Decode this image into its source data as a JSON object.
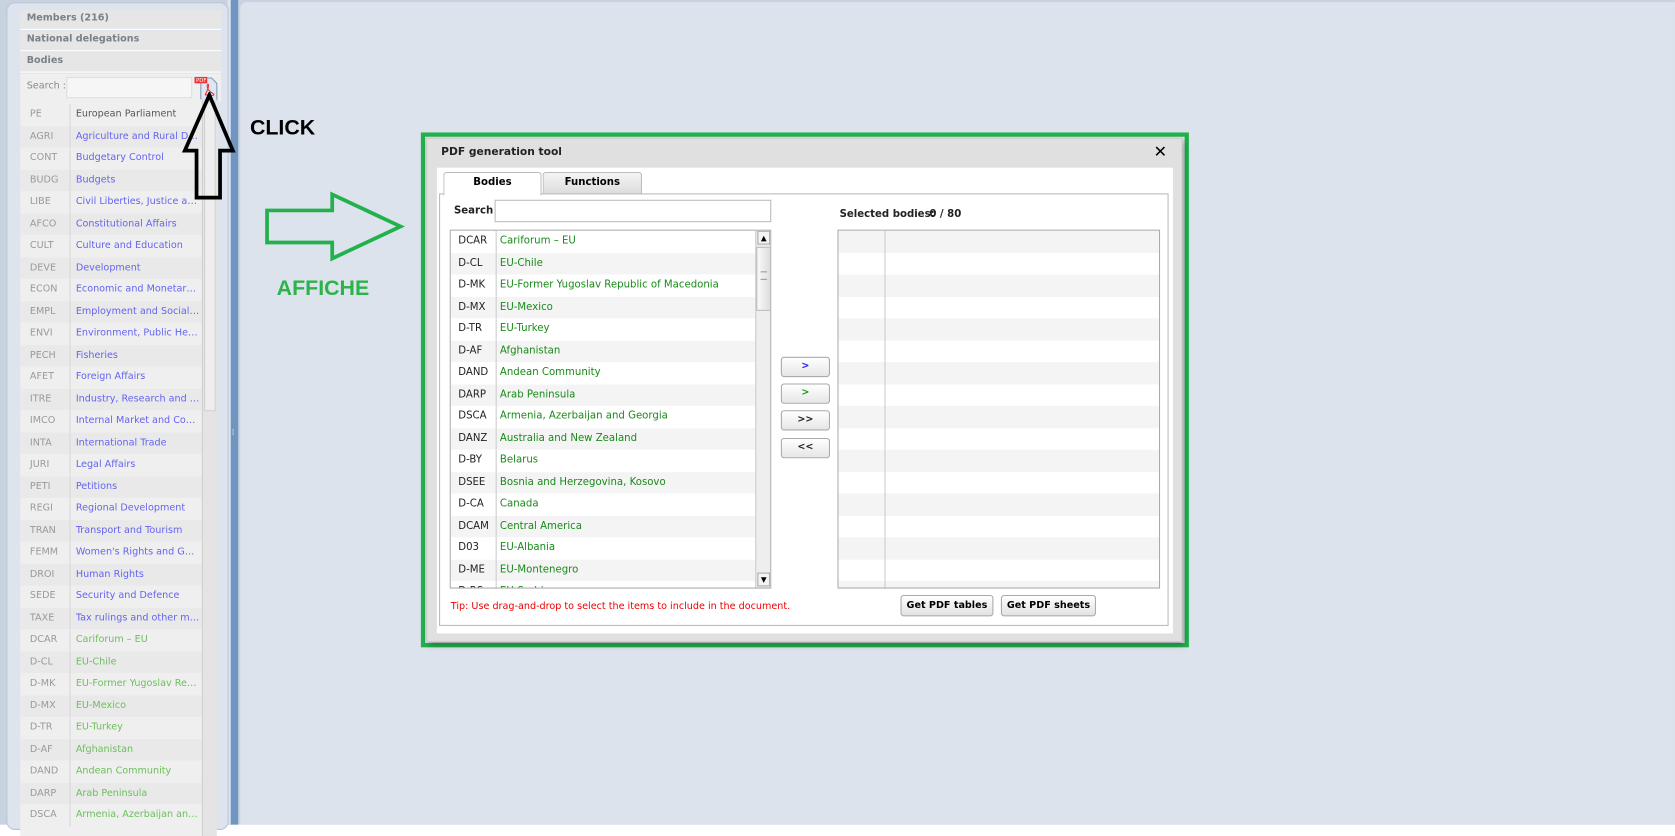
{
  "sidebar": {
    "sections": [
      "Members (216)",
      "National delegations",
      "Bodies"
    ],
    "search_label": "Search :",
    "search_value": "",
    "pdf_icon": "pdf-icon",
    "items": [
      {
        "code": "PE",
        "name": "European Parliament",
        "kind": "parliament"
      },
      {
        "code": "AGRI",
        "name": "Agriculture and Rural Deve...",
        "kind": "committee"
      },
      {
        "code": "CONT",
        "name": "Budgetary Control",
        "kind": "committee"
      },
      {
        "code": "BUDG",
        "name": "Budgets",
        "kind": "committee"
      },
      {
        "code": "LIBE",
        "name": "Civil Liberties, Justice and ...",
        "kind": "committee"
      },
      {
        "code": "AFCO",
        "name": "Constitutional Affairs",
        "kind": "committee"
      },
      {
        "code": "CULT",
        "name": "Culture and Education",
        "kind": "committee"
      },
      {
        "code": "DEVE",
        "name": "Development",
        "kind": "committee"
      },
      {
        "code": "ECON",
        "name": "Economic and Monetary Aff...",
        "kind": "committee"
      },
      {
        "code": "EMPL",
        "name": "Employment and Social Aff...",
        "kind": "committee"
      },
      {
        "code": "ENVI",
        "name": "Environment, Public Health...",
        "kind": "committee"
      },
      {
        "code": "PECH",
        "name": "Fisheries",
        "kind": "committee"
      },
      {
        "code": "AFET",
        "name": "Foreign Affairs",
        "kind": "committee"
      },
      {
        "code": "ITRE",
        "name": "Industry, Research and Ene...",
        "kind": "committee"
      },
      {
        "code": "IMCO",
        "name": "Internal Market and Consu...",
        "kind": "committee"
      },
      {
        "code": "INTA",
        "name": "International Trade",
        "kind": "committee"
      },
      {
        "code": "JURI",
        "name": "Legal Affairs",
        "kind": "committee"
      },
      {
        "code": "PETI",
        "name": "Petitions",
        "kind": "committee"
      },
      {
        "code": "REGI",
        "name": "Regional Development",
        "kind": "committee"
      },
      {
        "code": "TRAN",
        "name": "Transport and Tourism",
        "kind": "committee"
      },
      {
        "code": "FEMM",
        "name": "Women's Rights and Gend...",
        "kind": "committee"
      },
      {
        "code": "DROI",
        "name": "Human Rights",
        "kind": "committee"
      },
      {
        "code": "SEDE",
        "name": "Security and Defence",
        "kind": "committee"
      },
      {
        "code": "TAXE",
        "name": "Tax rulings and other meas...",
        "kind": "committee"
      },
      {
        "code": "DCAR",
        "name": "Cariforum – EU",
        "kind": "delegation"
      },
      {
        "code": "D-CL",
        "name": "EU-Chile",
        "kind": "delegation"
      },
      {
        "code": "D-MK",
        "name": "EU-Former Yugoslav Repu...",
        "kind": "delegation"
      },
      {
        "code": "D-MX",
        "name": "EU-Mexico",
        "kind": "delegation"
      },
      {
        "code": "D-TR",
        "name": "EU-Turkey",
        "kind": "delegation"
      },
      {
        "code": "D-AF",
        "name": "Afghanistan",
        "kind": "delegation"
      },
      {
        "code": "DAND",
        "name": "Andean Community",
        "kind": "delegation"
      },
      {
        "code": "DARP",
        "name": "Arab Peninsula",
        "kind": "delegation"
      },
      {
        "code": "DSCA",
        "name": "Armenia, Azerbaijan and G...",
        "kind": "delegation"
      }
    ]
  },
  "colors": {
    "parliament": "#555555",
    "committee": "#6464f0",
    "delegation": "#6cbf5c",
    "annotation_green": "#22b14c",
    "tip": "#ee0000"
  },
  "annotations": {
    "click": "CLICK",
    "affiche": "AFFICHE"
  },
  "dialog": {
    "title": "PDF generation tool",
    "close": "✕",
    "tabs": [
      "Bodies",
      "Functions"
    ],
    "active_tab": "Bodies",
    "search_label": "Search :",
    "search_value": "",
    "selected_label": "Selected bodies:",
    "selected_count": "0 / 80",
    "items": [
      {
        "code": "DCAR",
        "name": "Cariforum – EU"
      },
      {
        "code": "D-CL",
        "name": "EU-Chile"
      },
      {
        "code": "D-MK",
        "name": "EU-Former Yugoslav Republic of Macedonia"
      },
      {
        "code": "D-MX",
        "name": "EU-Mexico"
      },
      {
        "code": "D-TR",
        "name": "EU-Turkey"
      },
      {
        "code": "D-AF",
        "name": "Afghanistan"
      },
      {
        "code": "DAND",
        "name": "Andean Community"
      },
      {
        "code": "DARP",
        "name": "Arab Peninsula"
      },
      {
        "code": "DSCA",
        "name": "Armenia, Azerbaijan and Georgia"
      },
      {
        "code": "DANZ",
        "name": "Australia and New Zealand"
      },
      {
        "code": "D-BY",
        "name": "Belarus"
      },
      {
        "code": "DSEE",
        "name": "Bosnia and Herzegovina, Kosovo"
      },
      {
        "code": "D-CA",
        "name": "Canada"
      },
      {
        "code": "DCAM",
        "name": "Central America"
      },
      {
        "code": "D03",
        "name": "EU-Albania"
      },
      {
        "code": "D-ME",
        "name": "EU-Montenegro"
      },
      {
        "code": "D-RS",
        "name": "EU-Serbia"
      }
    ],
    "move_buttons": [
      {
        "label": ">",
        "color": "#2020ee"
      },
      {
        "label": ">",
        "color": "#1a9a1a"
      },
      {
        "label": ">>",
        "color": "#222222"
      },
      {
        "label": "<<",
        "color": "#222222"
      }
    ],
    "tip": "Tip: Use drag-and-drop to select the items to include in the document.",
    "get_tables": "Get PDF tables",
    "get_sheets": "Get PDF sheets"
  }
}
